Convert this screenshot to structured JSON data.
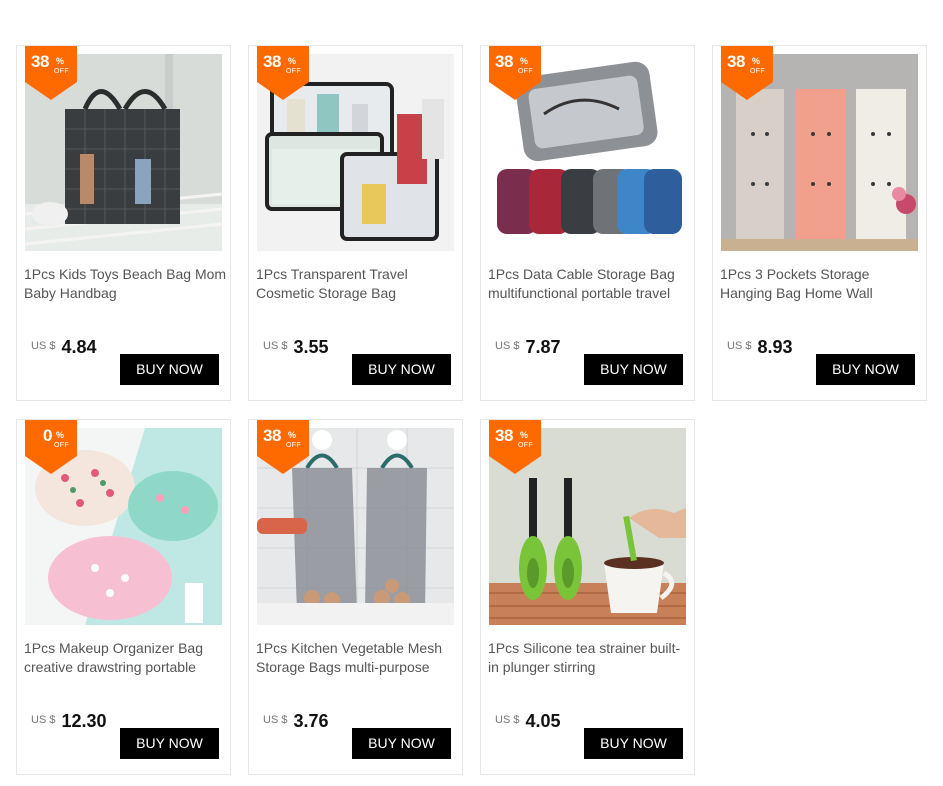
{
  "products": [
    {
      "discount": "38",
      "pct": "%",
      "off": "OFF",
      "title": "1Pcs Kids Toys Beach Bag Mom Baby Handbag",
      "currency": "US $",
      "price": "4.84",
      "button": "BUY NOW"
    },
    {
      "discount": "38",
      "pct": "%",
      "off": "OFF",
      "title": "1Pcs Transparent Travel Cosmetic Storage Bag",
      "currency": "US $",
      "price": "3.55",
      "button": "BUY NOW"
    },
    {
      "discount": "38",
      "pct": "%",
      "off": "OFF",
      "title": "1Pcs Data Cable Storage Bag multifunctional portable travel",
      "currency": "US $",
      "price": "7.87",
      "button": "BUY NOW"
    },
    {
      "discount": "38",
      "pct": "%",
      "off": "OFF",
      "title": "1Pcs 3 Pockets Storage Hanging Bag Home Wall",
      "currency": "US $",
      "price": "8.93",
      "button": "BUY NOW"
    },
    {
      "discount": "0",
      "pct": "%",
      "off": "OFF",
      "title": "1Pcs Makeup Organizer Bag creative drawstring portable",
      "currency": "US $",
      "price": "12.30",
      "button": "BUY NOW"
    },
    {
      "discount": "38",
      "pct": "%",
      "off": "OFF",
      "title": "1Pcs Kitchen Vegetable Mesh Storage Bags multi-purpose",
      "currency": "US $",
      "price": "3.76",
      "button": "BUY NOW"
    },
    {
      "discount": "38",
      "pct": "%",
      "off": "OFF",
      "title": "1Pcs Silicone tea strainer built-in plunger stirring",
      "currency": "US $",
      "price": "4.05",
      "button": "BUY NOW"
    }
  ],
  "colors": {
    "badge": "#ff6a00",
    "button": "#000000",
    "border": "#e6e6e6"
  }
}
